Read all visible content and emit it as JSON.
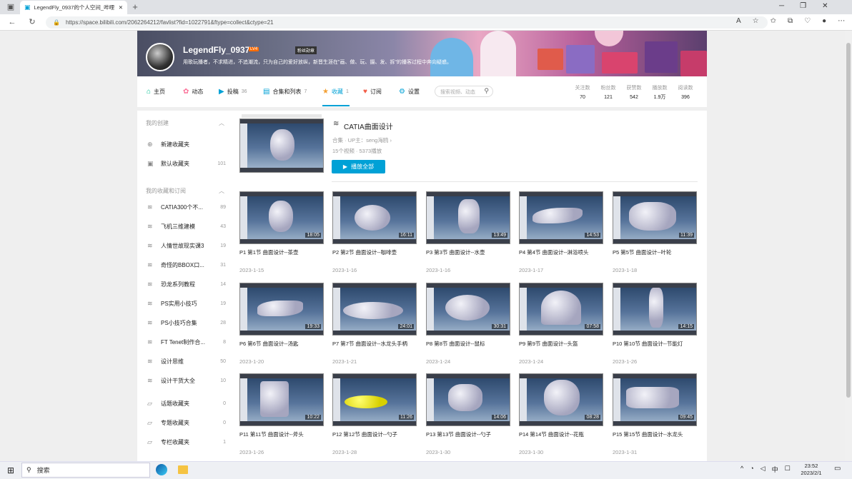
{
  "browser": {
    "tab_title": "LegendFly_0937的个人空间_哔哩",
    "url": "https://space.bilibili.com/2062264212/favlist?fid=1022791&ftype=collect&ctype=21"
  },
  "profile": {
    "username": "LegendFly_0937",
    "level": "LV4",
    "medal": "粉丝勋章",
    "sign": "用歌玩播者，不求精进，不追潮流，只为自己的爱好放纵，新晋生涯在\"画、做、玩、摄、发、拆\"的播客过程中奔向疑惑。"
  },
  "nav": {
    "home": "主页",
    "dynamic": "动态",
    "upload": "投稿",
    "upload_count": "36",
    "collections": "合集和列表",
    "collections_count": "7",
    "favorites": "收藏",
    "favorites_count": "1",
    "subscriptions": "订阅",
    "settings": "设置",
    "search_placeholder": "搜索视频、动态"
  },
  "stats": [
    {
      "label": "关注数",
      "value": "70"
    },
    {
      "label": "粉丝数",
      "value": "121"
    },
    {
      "label": "获赞数",
      "value": "542"
    },
    {
      "label": "播放数",
      "value": "1.9万"
    },
    {
      "label": "阅读数",
      "value": "396"
    }
  ],
  "sidebar": {
    "my_created": "我的创建",
    "created": [
      {
        "label": "新建收藏夹",
        "count": ""
      },
      {
        "label": "默认收藏夹",
        "count": "101"
      }
    ],
    "my_subscribed": "我的收藏和订阅",
    "subscribed": [
      {
        "label": "CATIA300个不...",
        "count": "89"
      },
      {
        "label": "飞机三维建模",
        "count": "43"
      },
      {
        "label": "人情世故现实课3",
        "count": "19"
      },
      {
        "label": "奇怪的BBOX口...",
        "count": "31"
      },
      {
        "label": "恐龙系列教程",
        "count": "14"
      },
      {
        "label": "PS实用小技巧",
        "count": "19"
      },
      {
        "label": "PS小技巧合集",
        "count": "28"
      },
      {
        "label": "FT Tenet制作合...",
        "count": "8"
      },
      {
        "label": "设计思维",
        "count": "50"
      },
      {
        "label": "设计干货大全",
        "count": "10"
      }
    ],
    "others": [
      {
        "label": "话题收藏夹",
        "count": "0"
      },
      {
        "label": "专题收藏夹",
        "count": "0"
      },
      {
        "label": "专栏收藏夹",
        "count": "1"
      }
    ]
  },
  "folder": {
    "title": "CATIA曲面设计",
    "meta": "合集 · UP主：seng海鸥",
    "count": "15个视频 · 5373播放",
    "play_all": "播放全部",
    "cover_duration": ""
  },
  "videos": [
    {
      "title": "P1 第1节 曲面设计--茶壶",
      "date": "2023-1-15",
      "duration": "18:05"
    },
    {
      "title": "P2 第2节 曲面设计--咖啡壶",
      "date": "2023-1-16",
      "duration": "16:11"
    },
    {
      "title": "P3 第3节 曲面设计--水壶",
      "date": "2023-1-16",
      "duration": "13:49"
    },
    {
      "title": "P4 第4节 曲面设计--淋浴喷头",
      "date": "2023-1-17",
      "duration": "14:53"
    },
    {
      "title": "P5 第5节 曲面设计--叶轮",
      "date": "2023-1-18",
      "duration": "11:39"
    },
    {
      "title": "P6 第6节 曲面设计--汤匙",
      "date": "2023-1-20",
      "duration": "19:33"
    },
    {
      "title": "P7 第7节 曲面设计--水龙头手柄",
      "date": "2023-1-21",
      "duration": "24:01"
    },
    {
      "title": "P8 第8节 曲面设计--鼠标",
      "date": "2023-1-24",
      "duration": "30:31"
    },
    {
      "title": "P9 第9节 曲面设计--头盔",
      "date": "2023-1-24",
      "duration": "07:58"
    },
    {
      "title": "P10 第10节 曲面设计--节能灯",
      "date": "2023-1-26",
      "duration": "14:15"
    },
    {
      "title": "P11 第11节 曲面设计--斧头",
      "date": "2023-1-26",
      "duration": "10:22"
    },
    {
      "title": "P12 第12节 曲面设计--勺子",
      "date": "2023-1-28",
      "duration": "11:26"
    },
    {
      "title": "P13 第13节 曲面设计--勺子",
      "date": "2023-1-30",
      "duration": "14:06"
    },
    {
      "title": "P14 第14节 曲面设计--花瓶",
      "date": "2023-1-30",
      "duration": "08:28"
    },
    {
      "title": "P15 第15节 曲面设计--水龙头",
      "date": "2023-1-31",
      "duration": "09:45"
    }
  ],
  "taskbar": {
    "search": "搜索",
    "ime": "中",
    "time": "23:52",
    "date": "2023/2/1"
  },
  "colors": {
    "accent": "#00a1d6"
  }
}
